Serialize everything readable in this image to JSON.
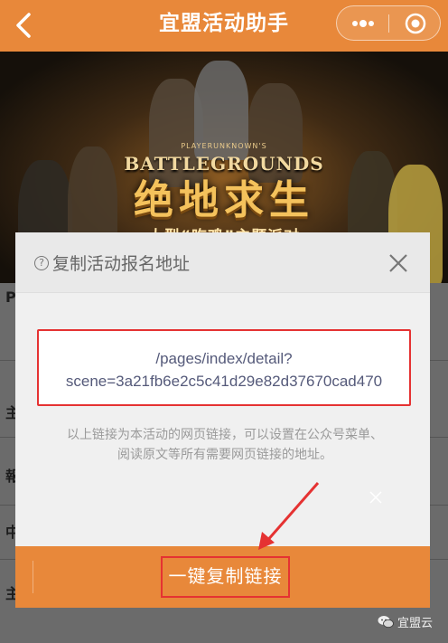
{
  "nav": {
    "title": "宜盟活动助手",
    "back_icon": "chevron-left-icon",
    "more_icon": "more-dots-icon",
    "close_icon": "target-circle-icon",
    "color": "#e8883a"
  },
  "banner": {
    "logo_small": "PLAYERUNKNOWN'S",
    "logo_en": "BATTLEGROUNDS",
    "logo_cn": "绝地求生",
    "logo_sub": "大型“吃鸡”主题派对"
  },
  "background": {
    "letters": [
      "P",
      "主",
      "報",
      "中",
      "主"
    ]
  },
  "modal": {
    "title": "复制活动报名地址",
    "help_icon_text": "?",
    "url_line1": "/pages/index/detail?",
    "url_line2": "scene=3a21fb6e2c5c41d29e82d37670cad470",
    "note_line1": "以上链接为本活动的网页链接，可以设置在公众号菜单、",
    "note_line2": "阅读原文等所有需要网页链接的地址。",
    "copy_button": "一键复制链接",
    "highlight_color": "#e53232"
  },
  "watermark": {
    "text": "宜盟云",
    "icon": "wechat-icon"
  }
}
